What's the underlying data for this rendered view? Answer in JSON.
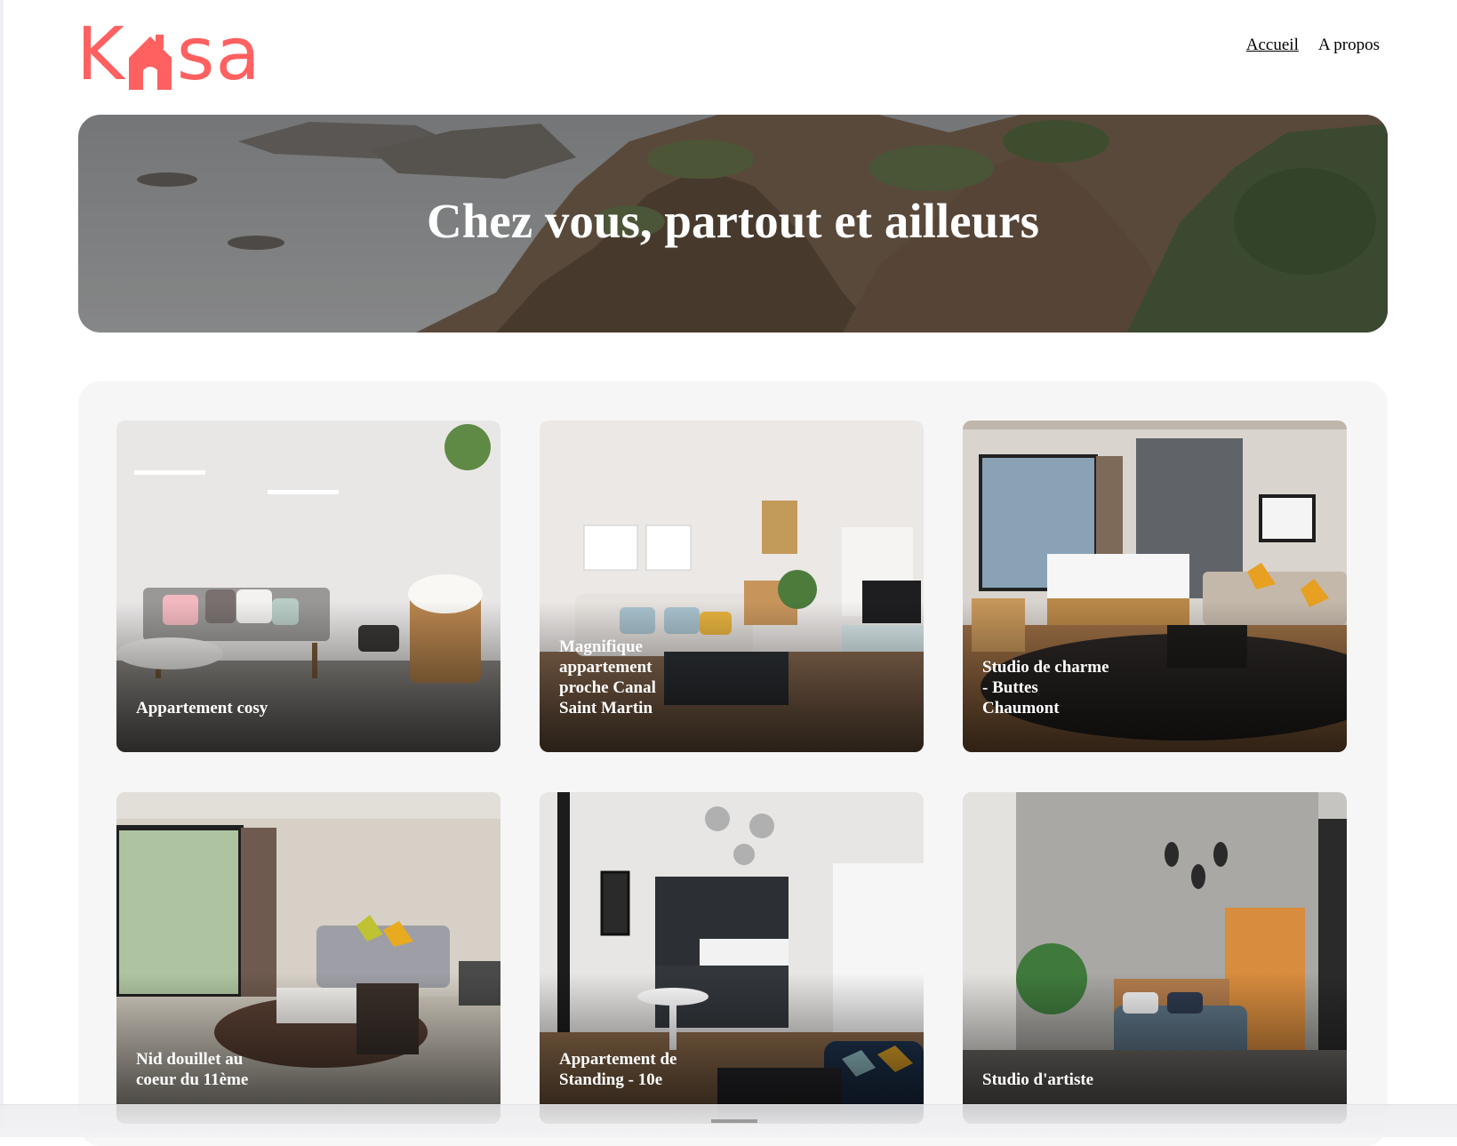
{
  "header": {
    "logo_prefix": "K",
    "logo_suffix": "sa",
    "nav": [
      "Accueil",
      "A propos"
    ]
  },
  "banner": {
    "title": "Chez vous, partout et ailleurs"
  },
  "gallery": {
    "cards": [
      {
        "title": "Appartement cosy"
      },
      {
        "title": "Magnifique appartement proche Canal Saint Martin"
      },
      {
        "title": "Studio de charme - Buttes Chaumont"
      },
      {
        "title": "Nid douillet au coeur du 11ème"
      },
      {
        "title": "Appartement de Standing - 10e"
      },
      {
        "title": "Studio d'artiste"
      }
    ]
  },
  "colors": {
    "brand": "#ff6060",
    "gallery_background": "#f6f6f6"
  },
  "icons": {
    "logo_house": "house-icon",
    "scroll_handle": "drag-handle-icon"
  }
}
